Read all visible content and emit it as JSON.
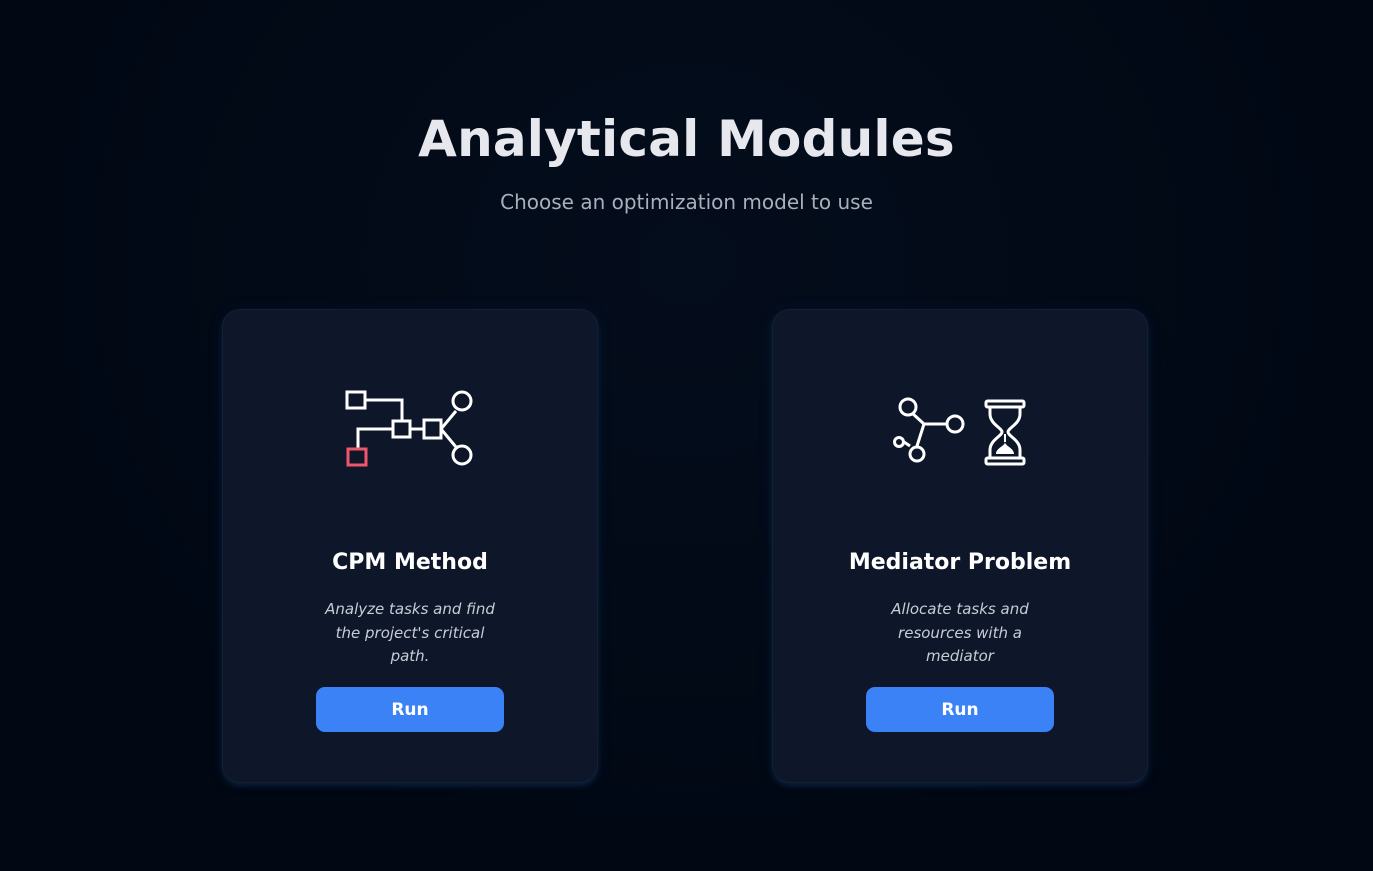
{
  "header": {
    "title": "Analytical Modules",
    "subtitle": "Choose an optimization model to use"
  },
  "cards": [
    {
      "icon": "network-graph-icon",
      "title": "CPM Method",
      "description": "Analyze tasks and find the project's critical path.",
      "button_label": "Run"
    },
    {
      "icon": "mediator-hourglass-icon",
      "title": "Mediator Problem",
      "description": "Allocate tasks and resources with a mediator",
      "button_label": "Run"
    }
  ],
  "colors": {
    "background": "#020a17",
    "card_background": "#0e1729",
    "button": "#3b82f6",
    "icon_stroke": "#ffffff",
    "critical_node": "#f0566a"
  }
}
